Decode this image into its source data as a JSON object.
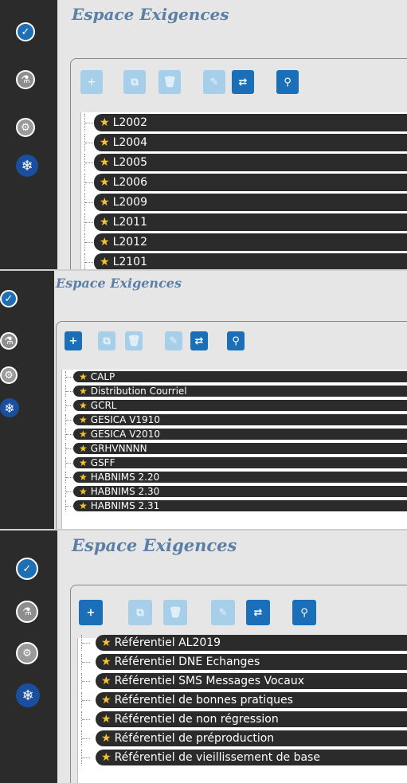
{
  "title": "Espace Exigences",
  "sidebar": {
    "icons": [
      "check-icon",
      "flask-icon",
      "gears-icon",
      "snowflake-logo-icon"
    ]
  },
  "toolbar": {
    "add": "+",
    "copy": "⧉",
    "delete": "🗑",
    "edit": "✎",
    "swap": "⇄",
    "search": "⚲"
  },
  "panels": [
    {
      "items": [
        "L2002",
        "L2004",
        "L2005",
        "L2006",
        "L2009",
        "L2011",
        "L2012",
        "L2101"
      ]
    },
    {
      "items": [
        "CALP",
        "Distribution Courriel",
        "GCRL",
        "GESICA V1910",
        "GESICA V2010",
        "GRHVNNNN",
        "GSFF",
        "HABNIMS 2.20",
        "HABNIMS 2.30",
        "HABNIMS 2.31"
      ]
    },
    {
      "items": [
        "Référentiel AL2019",
        "Référentiel DNE Echanges",
        "Référentiel SMS Messages Vocaux",
        "Référentiel de bonnes pratiques",
        "Référentiel de non régression",
        "Référentiel de préproduction",
        "Référentiel de vieillissement de base"
      ]
    }
  ],
  "colors": {
    "accent": "#1a6fb8",
    "disabled": "#a7cfe9",
    "pill": "#2b2b2b",
    "star": "#f4c430",
    "title": "#5b7fa6"
  }
}
